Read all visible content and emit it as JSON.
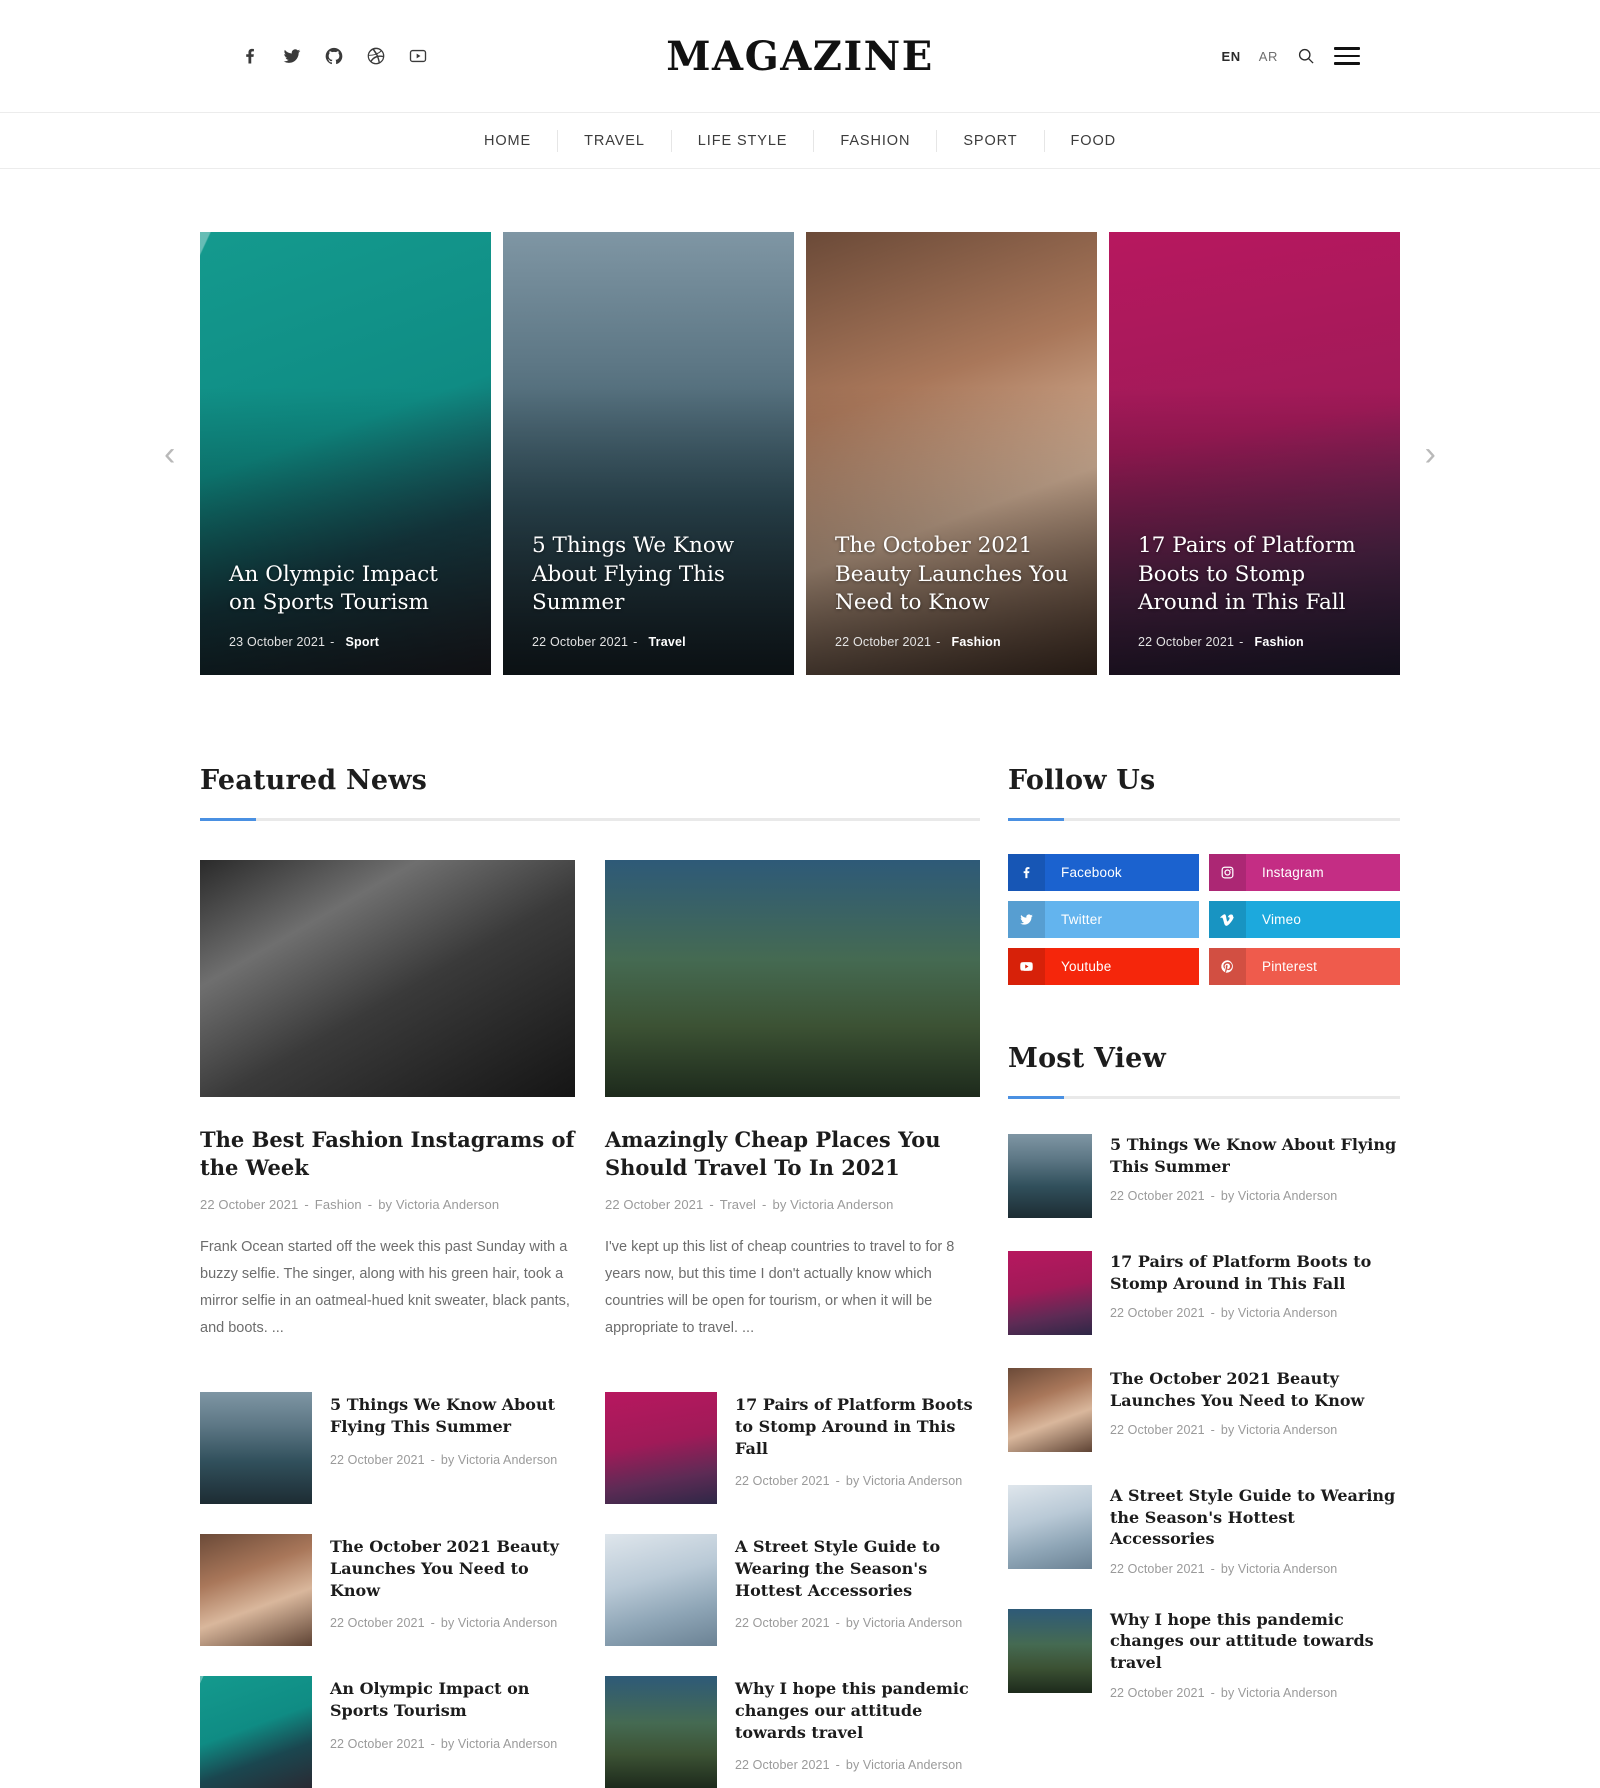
{
  "header": {
    "brand": "MAGAZINE",
    "social": [
      {
        "name": "facebook-icon",
        "label": "Facebook"
      },
      {
        "name": "twitter-icon",
        "label": "Twitter"
      },
      {
        "name": "github-icon",
        "label": "GitHub"
      },
      {
        "name": "dribbble-icon",
        "label": "Dribbble"
      },
      {
        "name": "youtube-icon",
        "label": "Youtube"
      }
    ],
    "lang_active": "EN",
    "lang_other": "AR",
    "search_label": "Search",
    "menu_label": "Menu"
  },
  "nav": {
    "items": [
      {
        "label": "HOME"
      },
      {
        "label": "TRAVEL"
      },
      {
        "label": "LIFE STYLE"
      },
      {
        "label": "FASHION"
      },
      {
        "label": "SPORT"
      },
      {
        "label": "FOOD"
      }
    ]
  },
  "carousel": {
    "prev": "‹",
    "next": "›",
    "slides": [
      {
        "title": "An Olympic Impact on Sports Tourism",
        "date": "23 October 2021",
        "dash": "-",
        "category": "Sport",
        "image": "img-tennis"
      },
      {
        "title": "5 Things We Know About Flying This Summer",
        "date": "22 October 2021",
        "dash": "-",
        "category": "Travel",
        "image": "img-lake"
      },
      {
        "title": "The October 2021 Beauty Launches You Need to Know",
        "date": "22 October 2021",
        "dash": "-",
        "category": "Fashion",
        "image": "img-beauty"
      },
      {
        "title": "17 Pairs of Platform Boots to Stomp Around in This Fall",
        "date": "22 October 2021",
        "dash": "-",
        "category": "Fashion",
        "image": "img-pink"
      }
    ]
  },
  "featured": {
    "heading": "Featured News",
    "cards": [
      {
        "title": "The Best Fashion Instagrams of the Week",
        "date": "22 October 2021",
        "category": "Fashion",
        "author": "by Victoria Anderson",
        "excerpt": "Frank Ocean started off the week this past Sunday with a buzzy selfie. The singer, along with his green hair, took a mirror selfie in an oatmeal-hued knit sweater, black pants, and boots. ...",
        "image": "img-vogue"
      },
      {
        "title": "Amazingly Cheap Places You Should Travel To In 2021",
        "date": "22 October 2021",
        "category": "Travel",
        "author": "by Victoria Anderson",
        "excerpt": "I've kept up this list of cheap countries to travel to for 8 years now, but this time I don't actually know which countries will be open for tourism, or when it will be appropriate to travel.  ...",
        "image": "img-camp"
      }
    ],
    "small_items": [
      {
        "title": "5 Things We Know About Flying This Summer",
        "date": "22 October 2021",
        "author": "by Victoria Anderson",
        "image": "img-lake"
      },
      {
        "title": "17 Pairs of Platform Boots to Stomp Around in This Fall",
        "date": "22 October 2021",
        "author": "by Victoria Anderson",
        "image": "img-pink"
      },
      {
        "title": "The October 2021 Beauty Launches You Need to Know",
        "date": "22 October 2021",
        "author": "by Victoria Anderson",
        "image": "img-beauty"
      },
      {
        "title": "A Street Style Guide to Wearing the Season's Hottest Accessories",
        "date": "22 October 2021",
        "author": "by Victoria Anderson",
        "image": "img-street"
      },
      {
        "title": "An Olympic Impact on Sports Tourism",
        "date": "22 October 2021",
        "author": "by Victoria Anderson",
        "image": "img-tennis"
      },
      {
        "title": "Why I hope this pandemic changes our attitude towards travel",
        "date": "22 October 2021",
        "author": "by Victoria Anderson",
        "image": "img-camp"
      }
    ]
  },
  "sidebar": {
    "follow": {
      "heading": "Follow Us",
      "buttons": [
        {
          "label": "Facebook",
          "icon": "facebook-icon",
          "color": "#1b62cf"
        },
        {
          "label": "Instagram",
          "icon": "instagram-icon",
          "color": "#c42d84"
        },
        {
          "label": "Twitter",
          "icon": "twitter-icon",
          "color": "#63b4ee"
        },
        {
          "label": "Vimeo",
          "icon": "vimeo-icon",
          "color": "#1ca9dd"
        },
        {
          "label": "Youtube",
          "icon": "youtube-icon",
          "color": "#f5260b"
        },
        {
          "label": "Pinterest",
          "icon": "pinterest-icon",
          "color": "#ef5b4c"
        }
      ]
    },
    "most_view": {
      "heading": "Most View",
      "items": [
        {
          "title": "5 Things We Know About Flying This Summer",
          "date": "22 October 2021",
          "author": "by Victoria Anderson",
          "image": "img-lake"
        },
        {
          "title": "17 Pairs of Platform Boots to Stomp Around in This Fall",
          "date": "22 October 2021",
          "author": "by Victoria Anderson",
          "image": "img-pink"
        },
        {
          "title": "The October 2021 Beauty Launches You Need to Know",
          "date": "22 October 2021",
          "author": "by Victoria Anderson",
          "image": "img-beauty"
        },
        {
          "title": "A Street Style Guide to Wearing the Season's Hottest Accessories",
          "date": "22 October 2021",
          "author": "by Victoria Anderson",
          "image": "img-street"
        },
        {
          "title": "Why I hope this pandemic changes our attitude towards travel",
          "date": "22 October 2021",
          "author": "by Victoria Anderson",
          "image": "img-camp"
        }
      ]
    }
  },
  "symbols": {
    "dash": "-"
  }
}
